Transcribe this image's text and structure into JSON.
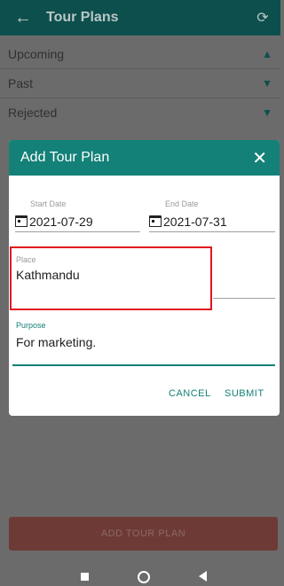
{
  "appbar": {
    "title": "Tour Plans",
    "back_icon": "arrow-left",
    "refresh_icon": "refresh"
  },
  "sections": [
    {
      "label": "Upcoming",
      "state": "expanded"
    },
    {
      "label": "Past",
      "state": "collapsed"
    },
    {
      "label": "Rejected",
      "state": "collapsed"
    }
  ],
  "dialog": {
    "title": "Add Tour Plan",
    "start_date_label": "Start Date",
    "start_date_value": "2021-07-29",
    "end_date_label": "End Date",
    "end_date_value": "2021-07-31",
    "place_label": "Place",
    "place_value": "Kathmandu",
    "purpose_label": "Purpose",
    "purpose_value": "For marketing.",
    "cancel_label": "CANCEL",
    "submit_label": "SUBMIT"
  },
  "add_button_label": "ADD TOUR PLAN",
  "colors": {
    "primary": "#138177",
    "appbar": "#0d4f4d",
    "highlight": "#e0161f"
  }
}
